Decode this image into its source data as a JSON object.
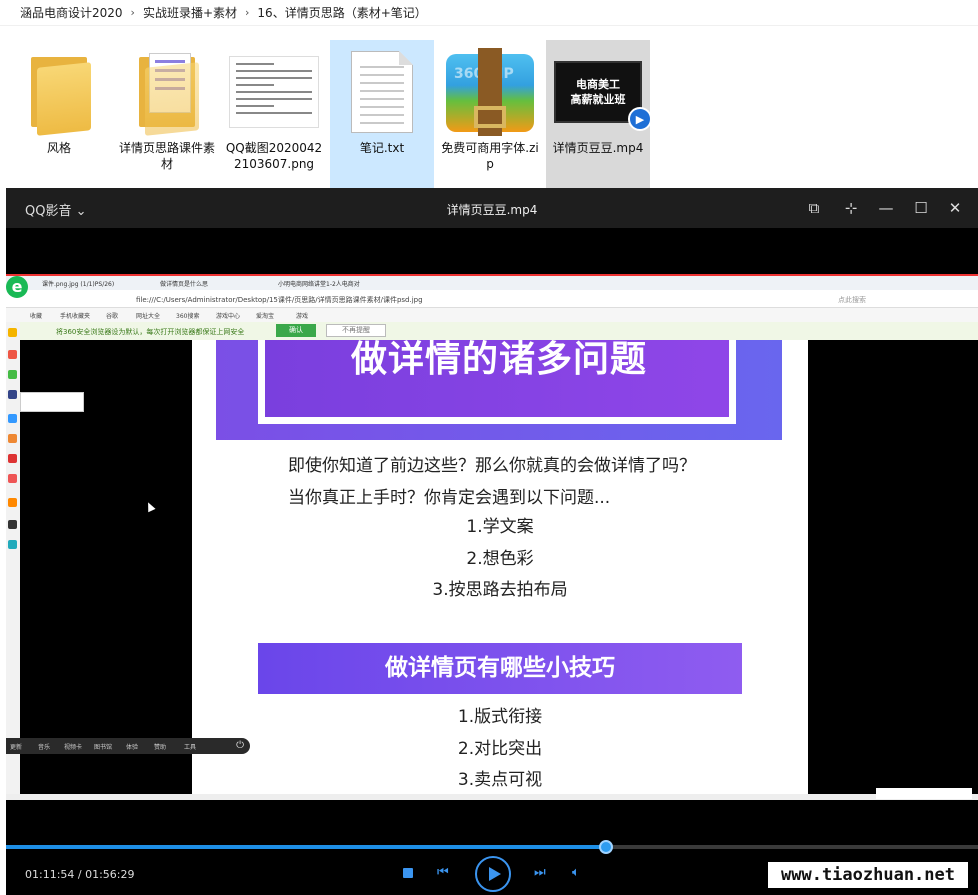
{
  "breadcrumb": [
    "涵品电商设计2020",
    "实战班录播+素材",
    "16、详情页思路（素材+笔记）"
  ],
  "files": [
    {
      "name": "风格",
      "icon": "folder-icon"
    },
    {
      "name": "详情页思路课件素材",
      "icon": "folder-icon"
    },
    {
      "name": "QQ截图20200422103607.png",
      "icon": "png-thumbnail"
    },
    {
      "name": "笔记.txt",
      "icon": "text-file-icon"
    },
    {
      "name": "免费可商用字体.zip",
      "icon": "zip-archive-icon",
      "badge": "360 ZIP"
    },
    {
      "name": "详情页豆豆.mp4",
      "icon": "video-thumbnail",
      "thumb_lines": [
        "电商美工",
        "高薪就业班"
      ]
    }
  ],
  "player": {
    "app_name": "QQ影音",
    "title": "详情页豆豆.mp4",
    "time": "01:11:54 / 01:56:29",
    "progress": 0.617,
    "accent": "#3b95f0"
  },
  "video": {
    "tabs": [
      "课件.png.jpg (1/1)PS/26)",
      "做详情页是什么思",
      "小明电商网络讲堂1-2人电商对"
    ],
    "address": "file:///C:/Users/Administrator/Desktop/15课件/页思路/详情页思路课件素材/课件psd.jpg",
    "search_placeholder": "点此搜索",
    "bookmarks": [
      "收藏",
      "手机收藏夹",
      "谷歌",
      "网址大全",
      "360搜索",
      "游戏中心",
      "爱淘宝",
      "游戏"
    ],
    "notice": "将360安全浏览器设为默认，每次打开浏览器都保证上网安全",
    "notice_btn": "确认",
    "notice_btn2": "不再提醒",
    "dock": [
      "更新",
      "音乐",
      "视频卡",
      "图书馆",
      "体验",
      "赞助",
      "工具"
    ],
    "headline": "做详情的诸多问题",
    "intro": [
      "即使你知道了前边这些？那么你就真的会做详情了吗？",
      "当你真正上手时？你肯定会遇到以下问题..."
    ],
    "list1": [
      "1.学文案",
      "2.想色彩",
      "3.按思路去拍布局"
    ],
    "section2": "做详情页有哪些小技巧",
    "list2": [
      "1.版式衔接",
      "2.对比突出",
      "3.卖点可视"
    ]
  },
  "watermark": "www.tiaozhuan.net"
}
